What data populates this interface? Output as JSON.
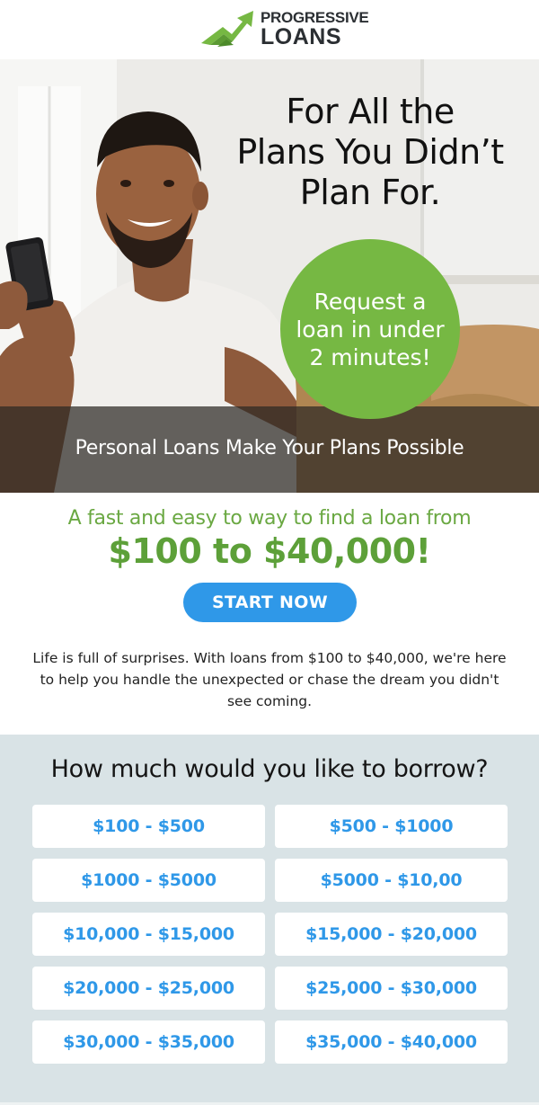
{
  "brand": {
    "name_top": "PROGRESSIVE",
    "name_bottom": "LOANS",
    "colors": {
      "green": "#76b843",
      "blue": "#2f98e8",
      "dark": "#2b2f33",
      "section_bg": "#d9e3e6"
    },
    "icon": "rising-arrow-logo-icon"
  },
  "hero": {
    "headline_lines": [
      "For All the",
      "Plans You Didn’t",
      "Plan For."
    ],
    "badge_lines": [
      "Request a",
      "loan in under",
      "2 minutes!"
    ],
    "band_text": "Personal Loans Make Your Plans Possible"
  },
  "intro": {
    "line": "A fast and easy to way to find a loan from",
    "amount": "$100 to $40,000!",
    "cta_label": "START NOW",
    "body": "Life is full of surprises. With loans from $100 to $40,000, we're here to help you handle the unexpected or chase the dream you didn't see coming."
  },
  "borrow": {
    "title": "How much would you like to borrow?",
    "options": [
      "$100 - $500",
      "$500 - $1000",
      "$1000 - $5000",
      "$5000 - $10,00",
      "$10,000 - $15,000",
      "$15,000 - $20,000",
      "$20,000 - $25,000",
      "$25,000 - $30,000",
      "$30,000 - $35,000",
      "$35,000 - $40,000"
    ]
  }
}
